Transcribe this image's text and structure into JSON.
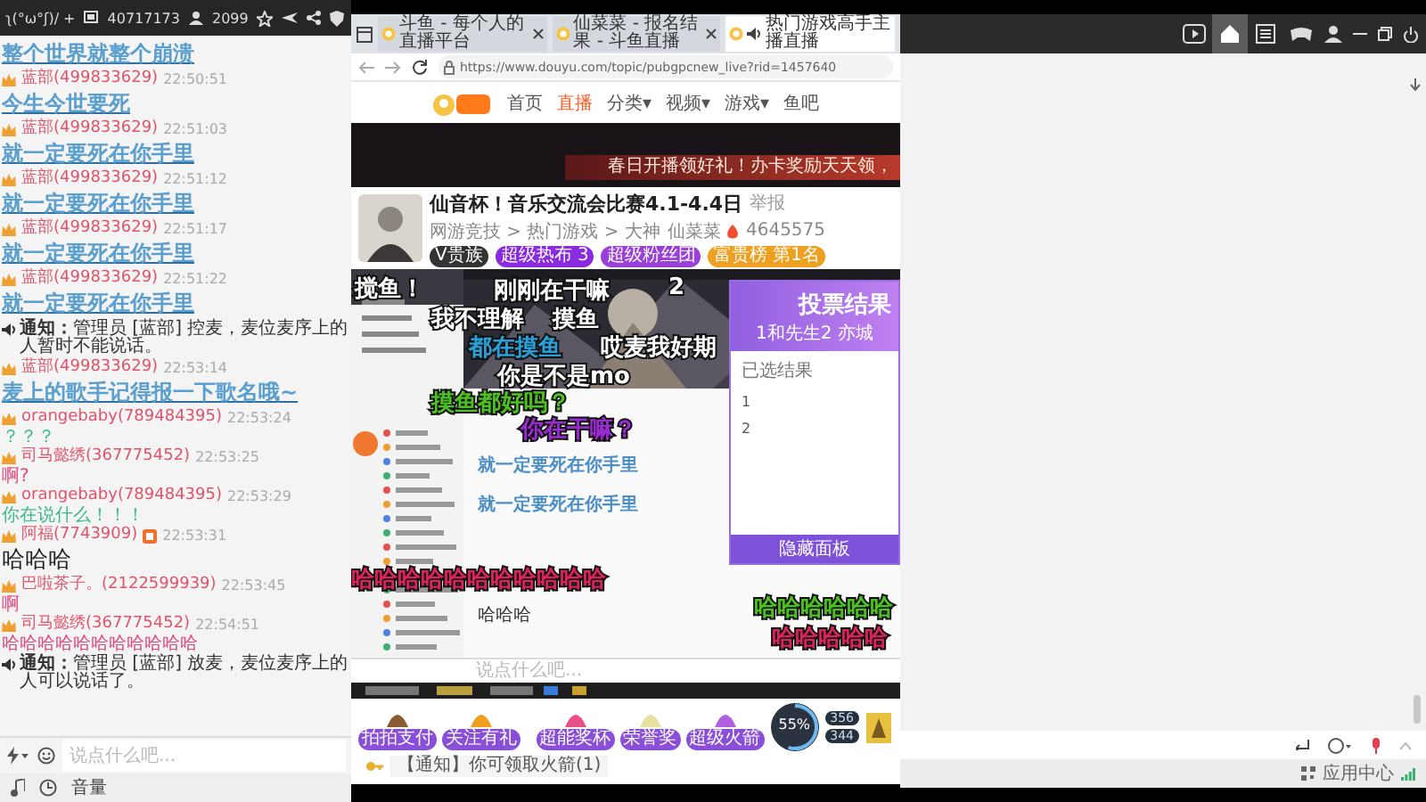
{
  "chat_panel": {
    "toolbar": {
      "emoticon": "ʅ(°ω°ʃ)/ +",
      "room_id": "40717173",
      "online": "2099"
    },
    "messages": [
      {
        "kind": "shout",
        "text": "整个世界就整个崩溃"
      },
      {
        "kind": "shout",
        "user": "蓝部(499833629)",
        "time": "22:50:51",
        "badge": false,
        "text": "今生今世要死"
      },
      {
        "kind": "shout",
        "user": "蓝部(499833629)",
        "time": "22:51:03",
        "badge": false,
        "text": "就一定要死在你手里"
      },
      {
        "kind": "shout",
        "user": "蓝部(499833629)",
        "time": "22:51:12",
        "badge": false,
        "text": "就一定要死在你手里"
      },
      {
        "kind": "shout",
        "user": "蓝部(499833629)",
        "time": "22:51:17",
        "badge": false,
        "text": "就一定要死在你手里"
      },
      {
        "kind": "shout",
        "user": "蓝部(499833629)",
        "time": "22:51:22",
        "badge": false,
        "text": "就一定要死在你手里"
      },
      {
        "kind": "notice",
        "text": "**通知：**管理员 [蓝部] 控麦，麦位麦序上的人暂时不能说话。"
      },
      {
        "kind": "shout",
        "user": "蓝部(499833629)",
        "time": "22:53:14",
        "badge": false,
        "text": "麦上的歌手记得报一下歌名哦~"
      },
      {
        "kind": "say",
        "user": "orangebaby(789484395)",
        "time": "22:53:24",
        "badge": false,
        "color": "#3cb98a",
        "text": "？？？"
      },
      {
        "kind": "say",
        "user": "司马懿绣(367775452)",
        "time": "22:53:25",
        "badge": false,
        "color": "#e5457a",
        "text": "啊?"
      },
      {
        "kind": "say",
        "user": "orangebaby(789484395)",
        "time": "22:53:29",
        "badge": false,
        "color": "#3cb98a",
        "text": "你在说什么！！！"
      },
      {
        "kind": "large",
        "user": "阿福(7743909)",
        "time": "22:53:31",
        "badge": true,
        "color": "#222222",
        "text": "哈哈哈"
      },
      {
        "kind": "say",
        "user": "巴啦茶子。(2122599939)",
        "time": "22:53:45",
        "badge": false,
        "color": "#e5457a",
        "text": "啊"
      },
      {
        "kind": "say",
        "user": "司马懿绣(367775452)",
        "time": "22:54:51",
        "badge": false,
        "color": "#e5457a",
        "text": "哈哈哈哈哈哈哈哈哈哈哈"
      },
      {
        "kind": "notice",
        "text": "**通知：**管理员 [蓝部] 放麦，麦位麦序上的人可以说话了。"
      }
    ],
    "input": {
      "placeholder": "说点什么吧..."
    },
    "footer": {
      "label": "音量"
    }
  },
  "browser": {
    "tabs": [
      {
        "title": "斗鱼 - 每个人的直播平台",
        "selected": false,
        "playing_audio": false
      },
      {
        "title": "仙菜菜 - 报名结果 - 斗鱼直播",
        "selected": false,
        "playing_audio": false
      },
      {
        "title": "热门游戏高手主播直播",
        "selected": true,
        "playing_audio": true
      }
    ],
    "url": "https://www.douyu.com/topic/pubgpcnew_live?rid=1457640",
    "nav": [
      {
        "label": "首页",
        "selected": false
      },
      {
        "label": "直播",
        "selected": true
      },
      {
        "label": "分类▾",
        "selected": false
      },
      {
        "label": "视频▾",
        "selected": false
      },
      {
        "label": "游戏▾",
        "selected": false
      },
      {
        "label": "鱼吧",
        "selected": false
      }
    ],
    "banner": "春日开播领好礼！办卡奖励天天领，",
    "stream": {
      "title": "仙音杯！音乐交流会比赛4.1-4.4日",
      "report": "举报",
      "category": "网游竞技 > 热门游戏 > 大神",
      "streamer": "仙菜菜",
      "heat": "4645575",
      "pills": [
        "V贵族",
        "超级热布 3",
        "超级粉丝团",
        "富贵榜 第1名"
      ]
    },
    "danmaku": [
      {
        "text": "搅鱼！",
        "color": "#ffffff"
      },
      {
        "text": "刚刚在干嘛",
        "color": "#ffffff"
      },
      {
        "text": "2",
        "color": "#ffffff"
      },
      {
        "text": "我不理解",
        "color": "#ffffff"
      },
      {
        "text": "摸鱼",
        "color": "#ffffff"
      },
      {
        "text": "都在摸鱼",
        "color": "#2a9fd8"
      },
      {
        "text": "哎麦我好期",
        "color": "#ffffff"
      },
      {
        "text": "你是不是mo",
        "color": "#ffffff"
      },
      {
        "text": "摸鱼都好吗？",
        "color": "#4cc020"
      },
      {
        "text": "你在干嘛？",
        "color": "#9b2bd0"
      },
      {
        "text": "哈哈哈哈哈哈哈哈哈哈哈",
        "color": "#d8245a"
      },
      {
        "text": "哈哈哈哈哈哈",
        "color": "#4cc020"
      },
      {
        "text": "哈哈哈哈哈",
        "color": "#d8245a"
      }
    ],
    "nested_chat": [
      "就一定要死在你手里",
      "就一定要死在你手里",
      "哈哈哈"
    ],
    "nested_input": {
      "placeholder": "说点什么吧..."
    },
    "vote": {
      "title": "投票结果",
      "subtitle": "1和先生2 亦城",
      "heading": "已选结果",
      "options": [
        "1",
        "2"
      ],
      "button": "隐藏面板"
    },
    "gifts": [
      "拍拍支付",
      "关注有礼",
      "超能奖杯",
      "荣誉奖",
      "超级火箭"
    ],
    "progress": {
      "label": "55%",
      "level": 0.55
    },
    "stats": [
      "356",
      "344"
    ],
    "notice": "【通知】你可领取火箭(1)"
  },
  "app": {
    "nav": [
      {
        "selected": false
      },
      {
        "selected": true
      },
      {
        "selected": false
      },
      {
        "selected": false
      }
    ],
    "status": "应用中心"
  }
}
